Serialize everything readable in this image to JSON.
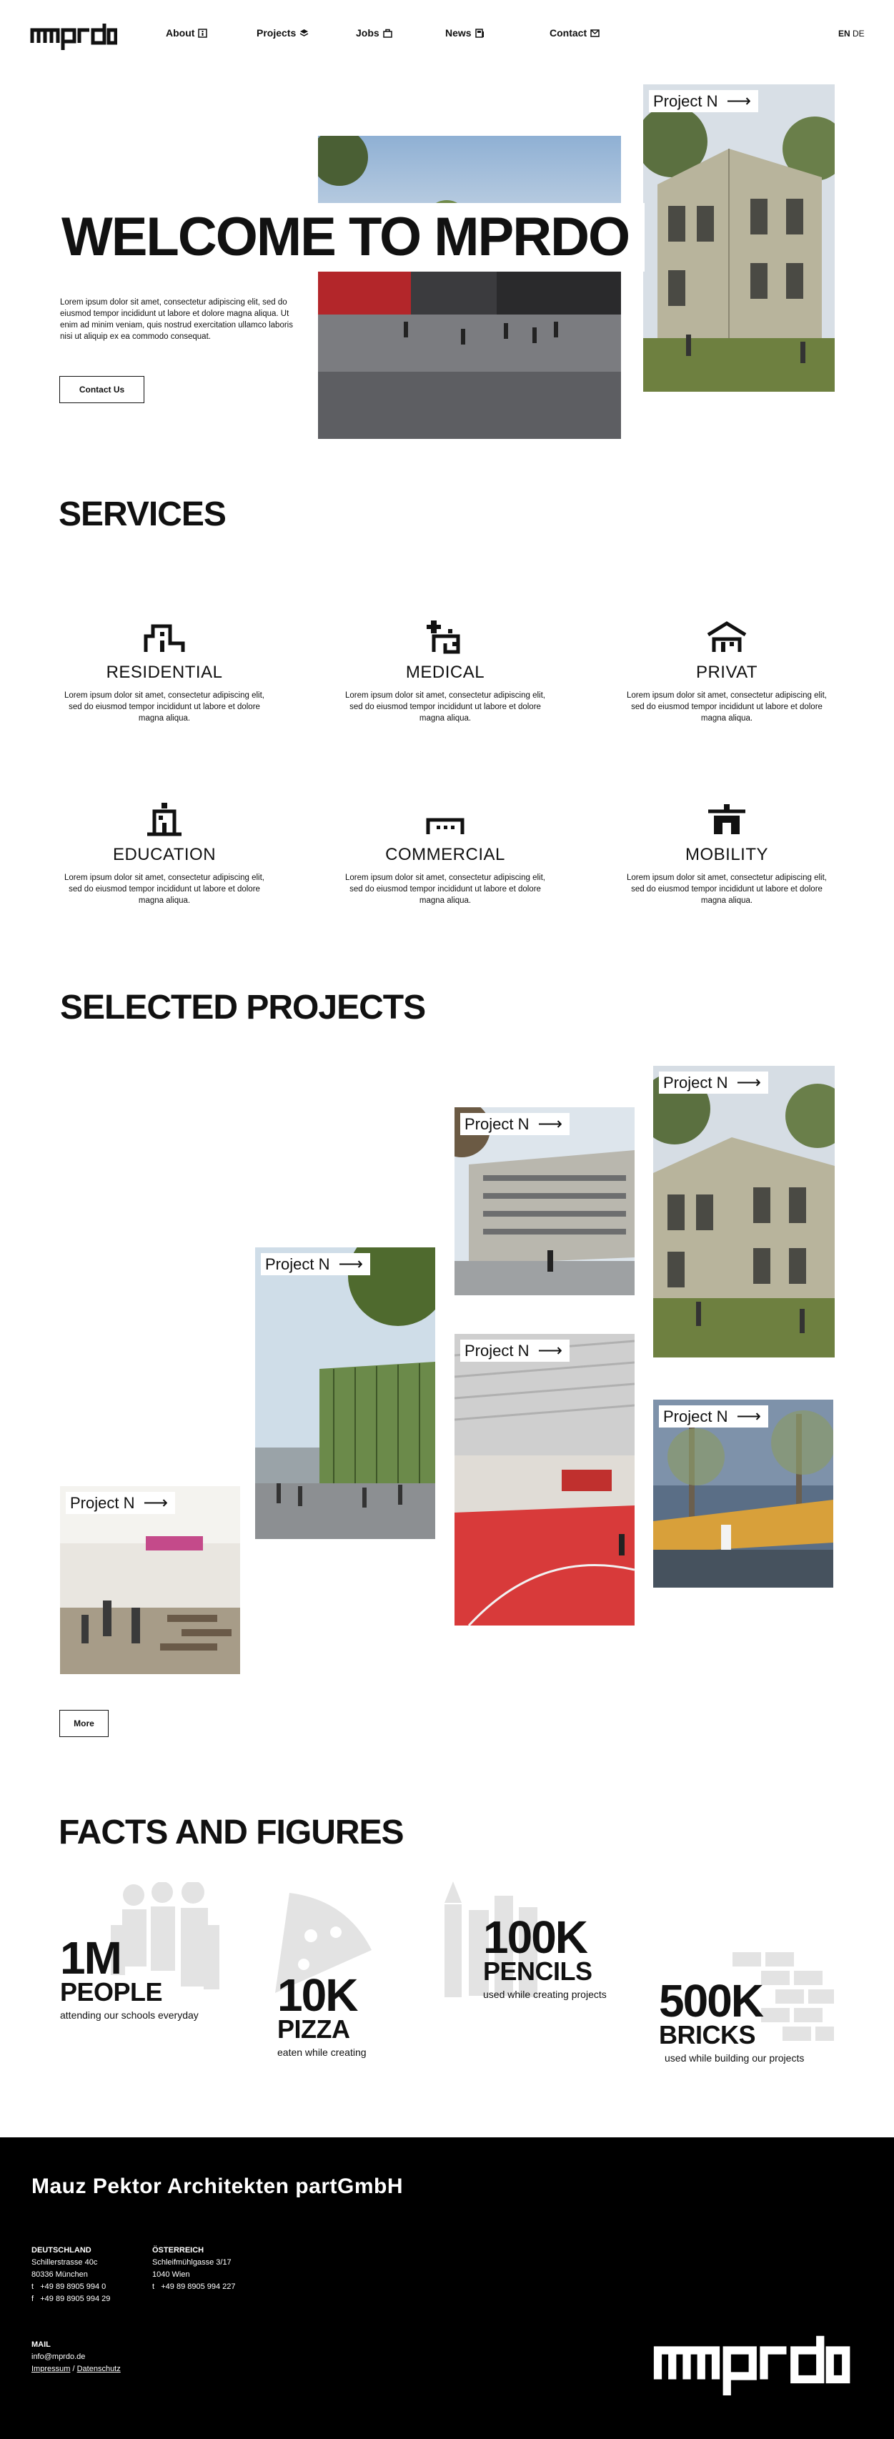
{
  "nav": {
    "logo_text": "mprdo",
    "items": [
      {
        "label": "About",
        "icon": "info-icon"
      },
      {
        "label": "Projects",
        "icon": "layers-icon"
      },
      {
        "label": "Jobs",
        "icon": "bag-icon"
      },
      {
        "label": "News",
        "icon": "newspaper-icon"
      },
      {
        "label": "Contact",
        "icon": "mail-icon"
      }
    ],
    "lang_en": "EN",
    "lang_de": "DE"
  },
  "hero": {
    "title": "WELCOME TO MPRDO",
    "text": "Lorem ipsum dolor sit amet, consectetur adipiscing elit, sed do eiusmod tempor incididunt ut labore et dolore magna aliqua. Ut enim ad minim veniam, quis nostrud exercitation ullamco laboris nisi ut aliquip ex ea commodo consequat.",
    "button": "Contact Us",
    "project_label": "Project N",
    "arrow": "⟶"
  },
  "services": {
    "title": "SERVICES",
    "items": [
      {
        "name": "RESIDENTIAL",
        "desc": "Lorem ipsum dolor sit amet, consectetur adipiscing elit, sed do eiusmod tempor incididunt ut labore et dolore magna aliqua.",
        "icon": "residential-icon"
      },
      {
        "name": "MEDICAL",
        "desc": "Lorem ipsum dolor sit amet, consectetur adipiscing elit, sed do eiusmod tempor incididunt ut labore et dolore magna aliqua.",
        "icon": "medical-icon"
      },
      {
        "name": "PRIVAT",
        "desc": "Lorem ipsum dolor sit amet, consectetur adipiscing elit, sed do eiusmod tempor incididunt ut labore et dolore magna aliqua.",
        "icon": "house-icon"
      },
      {
        "name": "EDUCATION",
        "desc": "Lorem ipsum dolor sit amet, consectetur adipiscing elit, sed do eiusmod tempor incididunt ut labore et dolore magna aliqua.",
        "icon": "education-icon"
      },
      {
        "name": "COMMERCIAL",
        "desc": "Lorem ipsum dolor sit amet, consectetur adipiscing elit, sed do eiusmod tempor incididunt ut labore et dolore magna aliqua.",
        "icon": "commercial-icon"
      },
      {
        "name": "MOBILITY",
        "desc": "Lorem ipsum dolor sit amet, consectetur adipiscing elit, sed do eiusmod tempor incididunt ut labore et dolore magna aliqua.",
        "icon": "mobility-icon"
      }
    ]
  },
  "projects": {
    "title": "SELECTED PROJECTS",
    "label": "Project N",
    "arrow": "⟶",
    "more": "More"
  },
  "facts": {
    "title": "FACTS AND FIGURES",
    "items": [
      {
        "big": "1M",
        "word": "PEOPLE",
        "sub": "attending our schools everyday",
        "icon": "people-icon"
      },
      {
        "big": "10K",
        "word": "PIZZA",
        "sub": "eaten while creating",
        "icon": "pizza-icon"
      },
      {
        "big": "100K",
        "word": "PENCILS",
        "sub": "used while creating projects",
        "icon": "pencils-icon"
      },
      {
        "big": "500K",
        "word": "BRICKS",
        "sub": "used while building our projects",
        "icon": "bricks-icon"
      }
    ]
  },
  "footer": {
    "company": "Mauz Pektor Architekten partGmbH",
    "de": {
      "heading": "DEUTSCHLAND",
      "street": "Schillerstrasse 40c",
      "city": "80336 München",
      "t_label": "t",
      "t": "+49 89 8905 994 0",
      "f_label": "f",
      "f": "+49 89 8905 994 29"
    },
    "at": {
      "heading": "ÖSTERREICH",
      "street": "Schleifmühlgasse 3/17",
      "city": "1040 Wien",
      "t_label": "t",
      "t": "+49 89 8905 994 227"
    },
    "mail_heading": "MAIL",
    "mail": "info@mprdo.de",
    "impressum": "Impressum",
    "sep": "/",
    "datenschutz": "Datenschutz",
    "logo_text": "mprdo"
  }
}
